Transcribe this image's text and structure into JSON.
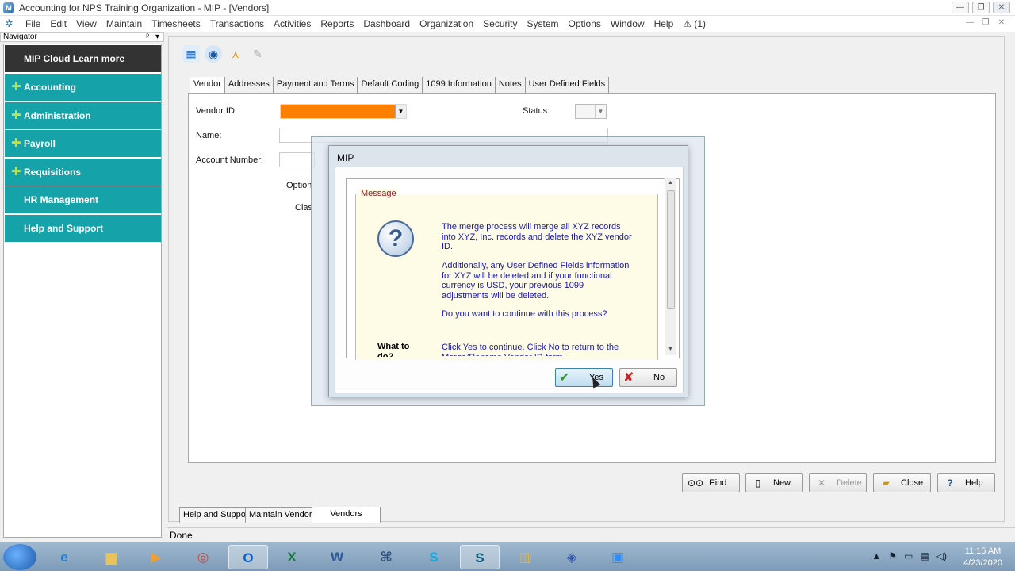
{
  "window": {
    "title": "Accounting for NPS Training Organization - MIP - [Vendors]",
    "minimize": "—",
    "restore": "❐",
    "close": "✕"
  },
  "menu": {
    "items": [
      "File",
      "Edit",
      "View",
      "Maintain",
      "Timesheets",
      "Transactions",
      "Activities",
      "Reports",
      "Dashboard",
      "Organization",
      "Security",
      "System",
      "Options",
      "Window",
      "Help"
    ],
    "notification": "(1)"
  },
  "navigator": {
    "header": "Navigator",
    "items": [
      {
        "label": "MIP Cloud Learn more",
        "plus": false
      },
      {
        "label": "Accounting",
        "plus": true
      },
      {
        "label": "Administration",
        "plus": true
      },
      {
        "label": "Payroll",
        "plus": true
      },
      {
        "label": "Requisitions",
        "plus": true
      },
      {
        "label": "HR Management",
        "plus": false
      },
      {
        "label": "Help and Support",
        "plus": false
      }
    ]
  },
  "form": {
    "tabs": [
      "Vendor",
      "Addresses",
      "Payment and Terms",
      "Default Coding",
      "1099 Information",
      "Notes",
      "User Defined Fields"
    ],
    "vendor_id_label": "Vendor ID:",
    "status_label": "Status:",
    "name_label": "Name:",
    "account_number_label": "Account Number:",
    "options_label": "Option",
    "class_label": "Clas"
  },
  "dialog": {
    "title": "MIP",
    "legend": "Message",
    "paragraph1": "The merge process will merge all XYZ records into XYZ, Inc. records and delete the XYZ vendor ID.",
    "paragraph2": "Additionally, any User Defined Fields information for XYZ will be deleted and if your functional currency is USD, your previous 1099 adjustments will be deleted.",
    "question": "Do you want to continue with this process?",
    "what_to_do_label": "What to do?",
    "what_to_do_text": "Click Yes to continue. Click No to return to the Merge/Rename Vendor ID form.",
    "yes_label": "Yes",
    "no_label": "No"
  },
  "buttons": {
    "find": "Find",
    "new": "New",
    "delete": "Delete",
    "close": "Close",
    "help": "Help"
  },
  "doc_tabs": [
    "Help and Support",
    "Maintain Vendors",
    "Vendors"
  ],
  "status_text": "Done",
  "taskbar": {
    "time": "11:15 AM",
    "date": "4/23/2020"
  },
  "colors": {
    "nav_teal": "#16a2a9",
    "vendor_id_highlight": "#ff8000"
  }
}
